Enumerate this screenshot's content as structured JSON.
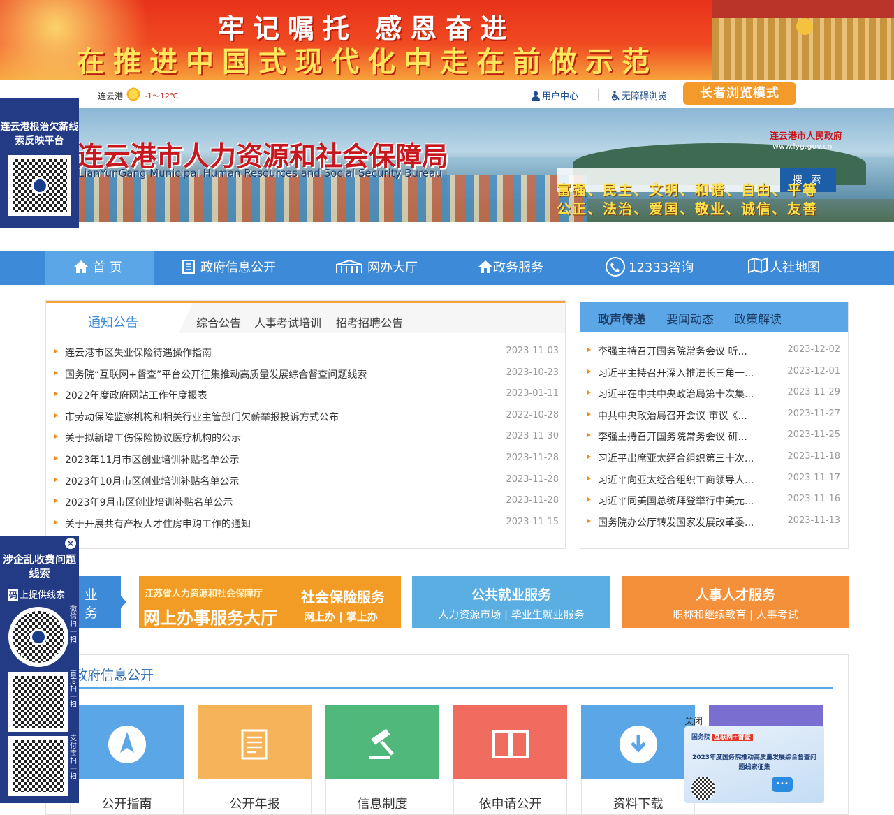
{
  "banner": {
    "line1": "牢记嘱托 感恩奋进",
    "line2": "在推进中国式现代化中走在前做示范"
  },
  "topbar": {
    "city": "连云港",
    "weather_icon": "sun-icon",
    "temperature": "-1～12℃",
    "user_center": "用户中心",
    "accessibility": "无障碍浏览",
    "elder_mode": "长者浏览模式"
  },
  "header": {
    "title_cn": "连云港市人力资源和社会保障局",
    "title_en": "LianYunGang Municipal Human Resources and Social Security Bureau",
    "gov_name": "连云港市人民政府",
    "gov_url": "www.lyg.gov.cn",
    "search_placeholder": "",
    "search_button": "搜 索",
    "slogan1": "富强、民主、文明、和谐、自由、平等",
    "slogan2": "公正、法治、爱国、敬业、诚信、友善"
  },
  "nav": {
    "items": [
      {
        "label": "首 页",
        "icon": "home-icon"
      },
      {
        "label": "政府信息公开",
        "icon": "document-icon"
      },
      {
        "label": "网办大厅",
        "icon": "hall-icon"
      },
      {
        "label": "政务服务",
        "icon": "house-icon"
      },
      {
        "label": "12333咨询",
        "icon": "phone-icon"
      },
      {
        "label": "人社地图",
        "icon": "map-icon"
      }
    ]
  },
  "notice": {
    "tabs": [
      "通知公告",
      "综合公告",
      "人事考试培训",
      "招考招聘公告"
    ],
    "items": [
      {
        "title": "连云港市区失业保险待遇操作指南",
        "date": "2023-11-03"
      },
      {
        "title": "国务院“互联网+督查”平台公开征集推动高质量发展综合督查问题线索",
        "date": "2023-10-23"
      },
      {
        "title": "2022年度政府网站工作年度报表",
        "date": "2023-01-11"
      },
      {
        "title": "市劳动保障监察机构和相关行业主管部门欠薪举报投诉方式公布",
        "date": "2022-10-28"
      },
      {
        "title": "关于拟新增工伤保险协议医疗机构的公示",
        "date": "2023-11-30"
      },
      {
        "title": "2023年11月市区创业培训补贴名单公示",
        "date": "2023-11-28"
      },
      {
        "title": "2023年10月市区创业培训补贴名单公示",
        "date": "2023-11-28"
      },
      {
        "title": "2023年9月市区创业培训补贴名单公示",
        "date": "2023-11-28"
      },
      {
        "title": "关于开展共有产权人才住房申购工作的通知",
        "date": "2023-11-15"
      }
    ]
  },
  "gov_news": {
    "tabs": [
      "政声传递",
      "要闻动态",
      "政策解读"
    ],
    "items": [
      {
        "title": "李强主持召开国务院常务会议 听...",
        "date": "2023-12-02"
      },
      {
        "title": "习近平主持召开深入推进长三角一...",
        "date": "2023-12-01"
      },
      {
        "title": "习近平在中共中央政治局第十次集...",
        "date": "2023-11-29"
      },
      {
        "title": "中共中央政治局召开会议 审议《...",
        "date": "2023-11-27"
      },
      {
        "title": "李强主持召开国务院常务会议 研...",
        "date": "2023-11-25"
      },
      {
        "title": "习近平出席亚太经合组织第三十次...",
        "date": "2023-11-18"
      },
      {
        "title": "习近平向亚太经合组织工商领导人...",
        "date": "2023-11-17"
      },
      {
        "title": "习近平同美国总统拜登举行中美元...",
        "date": "2023-11-16"
      },
      {
        "title": "国务院办公厅转发国家发展改革委...",
        "date": "2023-11-13"
      }
    ]
  },
  "services": {
    "left": {
      "line1": "业",
      "line2": "务"
    },
    "jiangsu": {
      "org": "江苏省人力资源和社会保障厅",
      "hall": "网上办事服务大厅",
      "title": "社会保险服务",
      "sub": "网上办 | 掌上办"
    },
    "employment": {
      "title": "公共就业服务",
      "sub": "人力资源市场 | 毕业生就业服务"
    },
    "talent": {
      "title": "人事人才服务",
      "sub": "职称和继续教育 | 人事考试"
    }
  },
  "info_open": {
    "title": "政府信息公开",
    "cards": [
      {
        "label": "公开指南",
        "icon": "compass-icon",
        "color": "#5aa6e6"
      },
      {
        "label": "公开年报",
        "icon": "newspaper-icon",
        "color": "#f5b35a"
      },
      {
        "label": "信息制度",
        "icon": "gavel-icon",
        "color": "#4fb87a"
      },
      {
        "label": "依申请公开",
        "icon": "book-icon",
        "color": "#ef6c5f"
      },
      {
        "label": "资料下载",
        "icon": "download-icon",
        "color": "#5aa6e6"
      }
    ]
  },
  "float_left_top": {
    "title": "连云港根治欠薪线索反映平台"
  },
  "float_left_bottom": {
    "title": "涉企乱收费问题线索",
    "close": "×",
    "code_tag": "码",
    "code_text": "上提供线索",
    "labels": [
      "微信扫一扫",
      "百度扫一扫",
      "支付宝扫一扫"
    ]
  },
  "float_right": {
    "close": "关闭",
    "tag": "国务院",
    "tag_badge": "互联网+督查",
    "title": "2023年度国务院推动高质量发展综合督查问题线索征集"
  }
}
